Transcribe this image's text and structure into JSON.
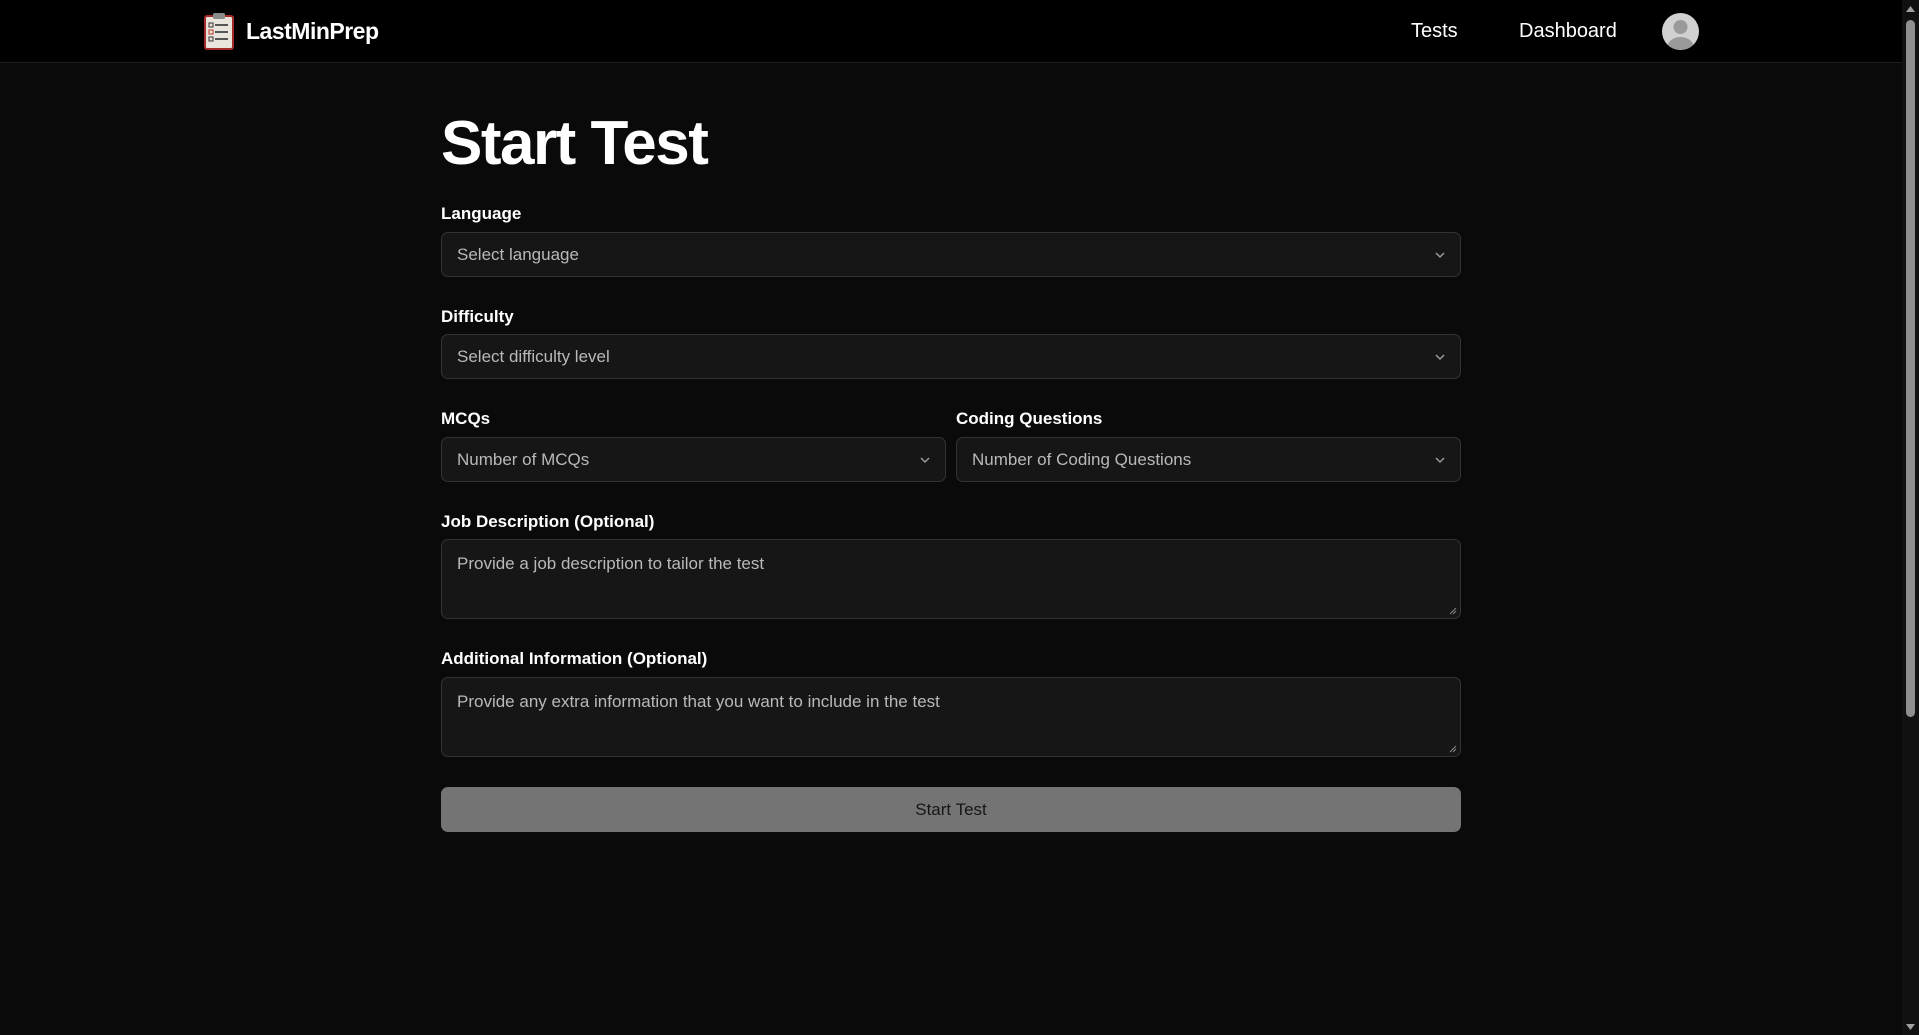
{
  "header": {
    "brand_name": "LastMinPrep",
    "logo_icon": "clipboard-icon",
    "nav": {
      "tests_label": "Tests",
      "dashboard_label": "Dashboard"
    },
    "avatar_icon": "user-avatar-icon"
  },
  "form": {
    "title": "Start Test",
    "language": {
      "label": "Language",
      "placeholder": "Select language"
    },
    "difficulty": {
      "label": "Difficulty",
      "placeholder": "Select difficulty level"
    },
    "mcqs": {
      "label": "MCQs",
      "placeholder": "Number of MCQs"
    },
    "coding_questions": {
      "label": "Coding Questions",
      "placeholder": "Number of Coding Questions"
    },
    "job_description": {
      "label": "Job Description (Optional)",
      "placeholder": "Provide a job description to tailor the test"
    },
    "additional_info": {
      "label": "Additional Information (Optional)",
      "placeholder": "Provide any extra information that you want to include in the test"
    },
    "submit_label": "Start Test"
  },
  "colors": {
    "background": "#0b0a0a",
    "topbar": "#000000",
    "field_background": "#161616",
    "field_border": "#333333",
    "button_background": "#747474",
    "button_text": "#161616"
  }
}
